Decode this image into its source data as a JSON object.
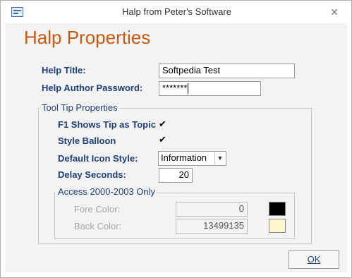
{
  "window": {
    "title": "Halp from Peter's Software",
    "close_glyph": "✕",
    "icon": "form-window-icon"
  },
  "heading": "Halp Properties",
  "fields": {
    "help_title_label": "Help Title:",
    "help_title_value": "Softpedia Test",
    "author_password_label": "Help Author Password:",
    "author_password_value": "*******"
  },
  "tooltip_group": {
    "title": "Tool Tip Properties",
    "f1_label": "F1 Shows Tip as Topic",
    "f1_checked": true,
    "style_balloon_label": "Style Balloon",
    "style_balloon_checked": true,
    "default_icon_label": "Default Icon Style:",
    "default_icon_value": "Information",
    "delay_label": "Delay Seconds:",
    "delay_value": "20",
    "check_glyph": "✔",
    "combo_arrow": "▼"
  },
  "access_group": {
    "title": "Access 2000-2003 Only",
    "fore_label": "Fore Color:",
    "fore_value": "0",
    "fore_color": "#000000",
    "back_label": "Back Color:",
    "back_value": "13499135",
    "back_color": "#fff7cd"
  },
  "ok_button": "OK",
  "colors": {
    "heading": "#c55a11",
    "label": "#1e3f7a",
    "dim_label": "#a6a6a6",
    "client_bg": "#f3f3f3"
  }
}
